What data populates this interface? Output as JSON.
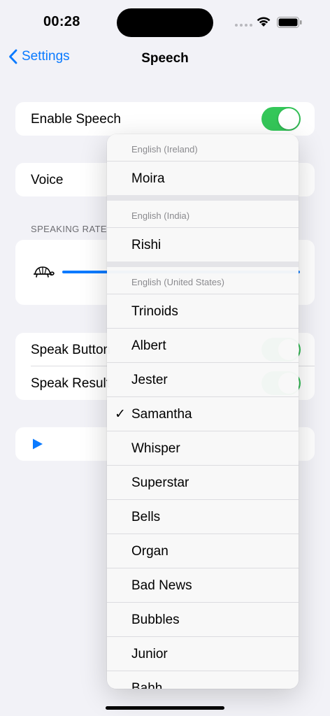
{
  "status": {
    "time": "00:28"
  },
  "nav": {
    "back_label": "Settings",
    "title": "Speech"
  },
  "settings": {
    "enable_speech": {
      "label": "Enable Speech",
      "on": true
    },
    "voice": {
      "label": "Voice"
    },
    "speaking_rate": {
      "header": "SPEAKING RATE"
    },
    "speak_button": {
      "label": "Speak Button",
      "on": true
    },
    "speak_result": {
      "label": "Speak Result",
      "on": true
    }
  },
  "voice_menu": {
    "group_ireland": {
      "header": "English (Ireland)",
      "items": [
        "Moira"
      ]
    },
    "group_india": {
      "header": "English (India)",
      "items": [
        "Rishi"
      ]
    },
    "group_us": {
      "header": "English (United States)",
      "items": [
        "Trinoids",
        "Albert",
        "Jester",
        "Samantha",
        "Whisper",
        "Superstar",
        "Bells",
        "Organ",
        "Bad News",
        "Bubbles",
        "Junior",
        "Bahh"
      ],
      "selected": "Samantha"
    },
    "check_mark": "✓"
  },
  "colors": {
    "accent": "#0a7aff",
    "toggle_on": "#34c759",
    "background": "#f2f2f7"
  }
}
